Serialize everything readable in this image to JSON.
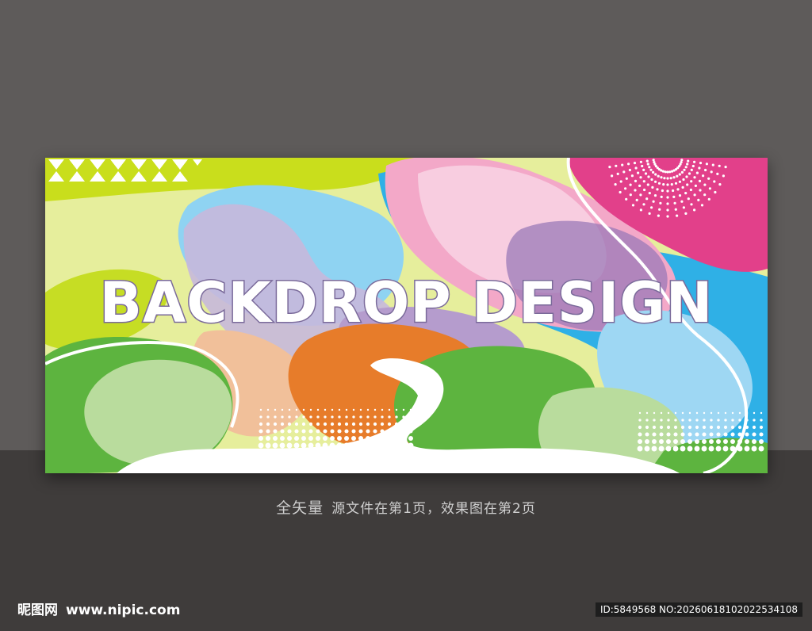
{
  "banner": {
    "headline": "BACKDROP DESIGN",
    "colors": {
      "lime": "#c9de1c",
      "pale_lime": "#e5ee98",
      "sky_blue": "#8fd3f2",
      "blue": "#2fb0e6",
      "pink": "#f3a8c8",
      "magenta": "#e2408a",
      "lavender": "#c7b8dc",
      "purple": "#9b79b8",
      "orange": "#e77c2a",
      "peach": "#f1c09a",
      "green": "#5db43f",
      "light_green": "#b9dc9d",
      "white": "#ffffff"
    }
  },
  "caption": {
    "lead": "全矢量",
    "text": "源文件在第1页，效果图在第2页"
  },
  "watermark": {
    "logo_text": "昵图网",
    "url": "www.nipic.com",
    "id_text": "ID:5849568 NO:20260618102022534108"
  }
}
